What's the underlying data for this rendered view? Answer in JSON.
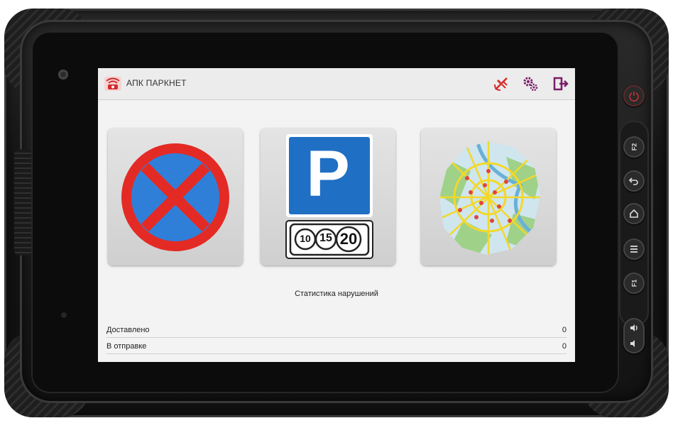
{
  "app": {
    "title": "АПК ПАРКНЕТ"
  },
  "toolbar": {
    "icons": [
      "gps-off-icon",
      "settings-gears-icon",
      "logout-icon"
    ]
  },
  "tiles": [
    {
      "name": "no-stopping-sign",
      "icon": "no-stopping-sign-icon"
    },
    {
      "name": "paid-parking",
      "icon": "parking-sign-icon",
      "zones": [
        "10",
        "15",
        "20"
      ],
      "letter": "P"
    },
    {
      "name": "map",
      "icon": "city-map-icon"
    }
  ],
  "stats": {
    "title": "Статистика нарушений",
    "rows": [
      {
        "label": "Доставлено",
        "value": "0"
      },
      {
        "label": "В отправке",
        "value": "0"
      }
    ]
  },
  "hardware_buttons": {
    "f2": "F2",
    "f1": "F1"
  },
  "colors": {
    "sign_red": "#e42a25",
    "sign_blue": "#2f7fd9",
    "parking_blue": "#1f6fc4",
    "accent_red": "#d52a2a"
  }
}
